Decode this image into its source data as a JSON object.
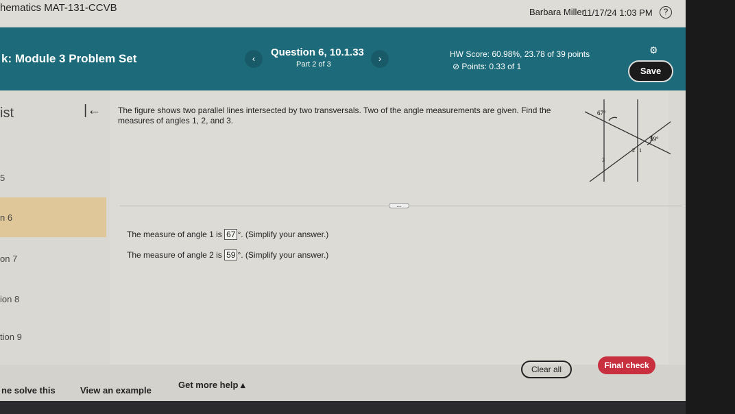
{
  "topbar": {
    "course": "hematics MAT-131-CCVB",
    "user": "Barbara Miller",
    "datetime": "11/17/24 1:03 PM",
    "help_icon": "question-circle-icon"
  },
  "header": {
    "homework_title": "k:  Module 3 Problem Set",
    "prev": "‹",
    "next": "›",
    "question": "Question 6, 10.1.33",
    "part": "Part 2 of 3",
    "hw_score": "HW Score: 60.98%, 23.78 of 39 points",
    "points": "Points: 0.33 of 1",
    "save_label": "Save",
    "accent": "#1d6b7a"
  },
  "sidebar": {
    "title": "ist",
    "items": [
      "5",
      "n 6",
      "on 7",
      "ion 8",
      "tion 9"
    ]
  },
  "question": {
    "prompt": "The figure shows two parallel lines intersected by two transversals. Two of the angle measurements are given. Find the measures of angles 1, 2, and 3.",
    "figure": {
      "angle_a": "67°",
      "angle_b": "59°",
      "label1": "1",
      "label2": "2",
      "label3": "3"
    },
    "answer1": {
      "prefix": "The measure of angle 1 is",
      "value": "67",
      "suffix": "°. (Simplify your answer.)"
    },
    "answer2": {
      "prefix": "The measure of angle 2 is",
      "value": "59",
      "suffix": "°. (Simplify your answer.)"
    }
  },
  "footer": {
    "help_solve": "ne solve this",
    "example": "View an example",
    "more_help": "Get more help ▴",
    "clear_all": "Clear all",
    "final_check": "Final check",
    "final_color": "#c8303f"
  }
}
